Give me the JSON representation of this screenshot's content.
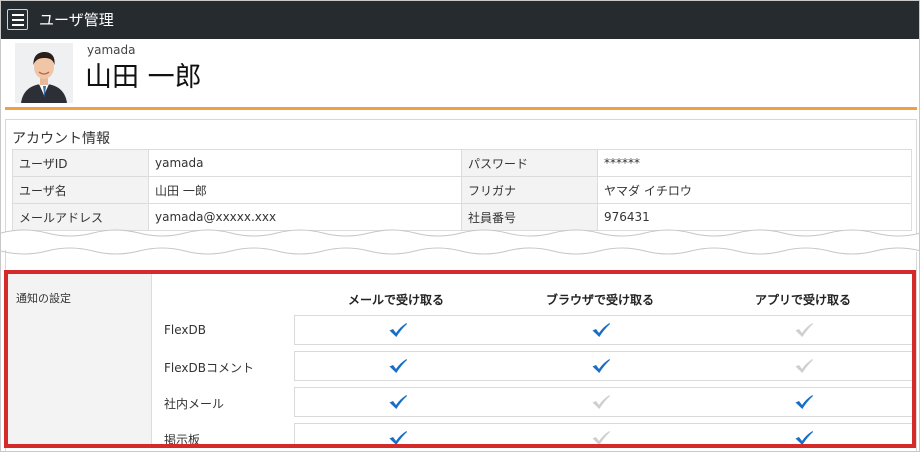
{
  "header": {
    "title": "ユーザ管理"
  },
  "profile": {
    "user_id": "yamada",
    "full_name": "山田 一郎"
  },
  "account": {
    "section_title": "アカウント情報",
    "rows": [
      {
        "label": "ユーザID",
        "value": "yamada",
        "label2": "パスワード",
        "value2": "******"
      },
      {
        "label": "ユーザ名",
        "value": "山田 一郎",
        "label2": "フリガナ",
        "value2": "ヤマダ イチロウ"
      },
      {
        "label": "メールアドレス",
        "value": "yamada@xxxxx.xxx",
        "label2": "社員番号",
        "value2": "976431"
      }
    ]
  },
  "notifications": {
    "label": "通知の設定",
    "columns": [
      "メールで受け取る",
      "ブラウザで受け取る",
      "アプリで受け取る"
    ],
    "rows": [
      {
        "name": "FlexDB",
        "mail": true,
        "browser": true,
        "app": false
      },
      {
        "name": "FlexDBコメント",
        "mail": true,
        "browser": true,
        "app": false
      },
      {
        "name": "社内メール",
        "mail": true,
        "browser": false,
        "app": true
      },
      {
        "name": "掲示板",
        "mail": true,
        "browser": false,
        "app": true
      }
    ]
  },
  "colors": {
    "header_bg": "#262b30",
    "accent_orange": "#f0a040",
    "highlight_red": "#d42a2a",
    "check_on": "#1a6fc4",
    "check_off": "#cfcfcf"
  }
}
